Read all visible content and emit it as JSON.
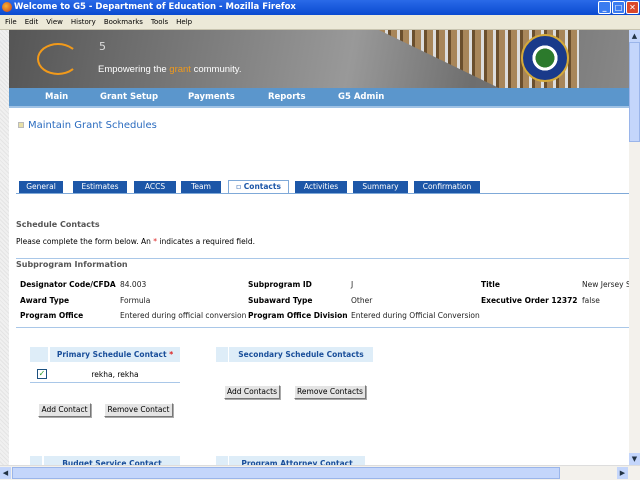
{
  "window": {
    "title": "Welcome to G5 - Department of Education - Mozilla Firefox"
  },
  "menu": [
    "File",
    "Edit",
    "View",
    "History",
    "Bookmarks",
    "Tools",
    "Help"
  ],
  "banner": {
    "logo_text": "G5",
    "tagline_pre": "Empowering the ",
    "tagline_accent": "grant",
    "tagline_post": " community",
    "accent_color": "#f29a1a"
  },
  "nav": [
    "Main",
    "Grant Setup",
    "Payments",
    "Reports",
    "G5 Admin"
  ],
  "page_title": "Maintain Grant Schedules",
  "tabs": [
    "General",
    "Estimates",
    "ACCS",
    "Team",
    "Contacts",
    "Activities",
    "Summary",
    "Confirmation"
  ],
  "active_tab": "Contacts",
  "schedule": {
    "heading": "Schedule Contacts",
    "instr_pre": "Please complete the form below. An ",
    "required_mark": "*",
    "instr_post": " indicates a required field."
  },
  "subprogram": {
    "heading": "Subprogram Information",
    "fields": [
      {
        "label": "Designator Code/CFDA",
        "value": "84.003"
      },
      {
        "label": "Subprogram ID",
        "value": "J"
      },
      {
        "label": "Title",
        "value": "New Jersey S"
      },
      {
        "label": "Award Type",
        "value": "Formula"
      },
      {
        "label": "Subaward Type",
        "value": "Other"
      },
      {
        "label": "Executive Order 12372",
        "value": "false"
      },
      {
        "label": "Program Office",
        "value": "Entered during official conversion"
      },
      {
        "label": "Program Office Division",
        "value": "Entered during Official Conversion"
      }
    ]
  },
  "contacts": {
    "primary": {
      "header": "Primary Schedule Contact",
      "required": "*",
      "rows": [
        {
          "checked": true,
          "name": "rekha, rekha"
        }
      ],
      "add": "Add Contact",
      "remove": "Remove Contact"
    },
    "secondary": {
      "header": "Secondary Schedule Contacts",
      "add": "Add Contacts",
      "remove": "Remove Contacts"
    },
    "budget": {
      "header": "Budget Service Contact"
    },
    "attorney": {
      "header": "Program Attorney Contact"
    }
  }
}
